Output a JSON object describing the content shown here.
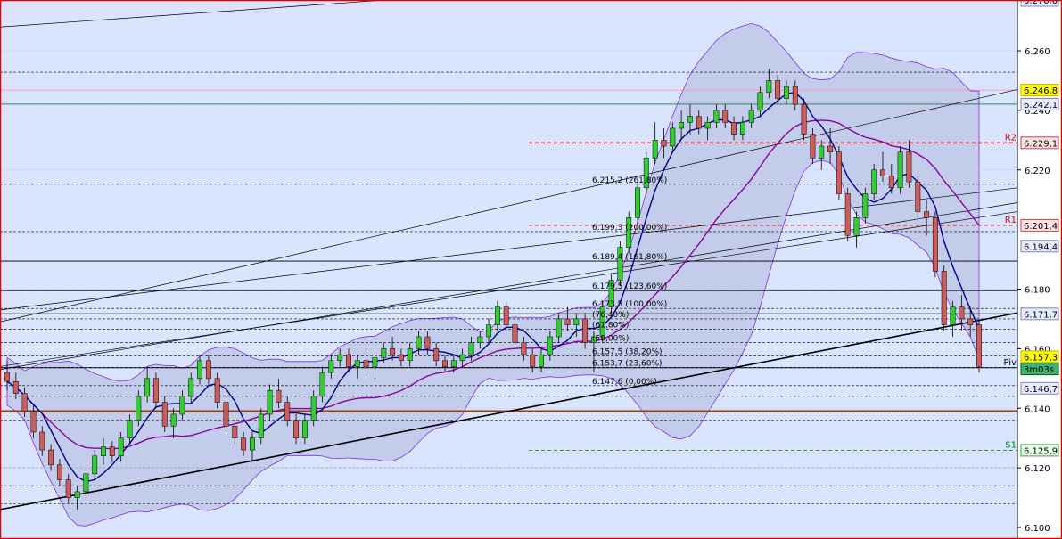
{
  "chart_data": {
    "type": "candlestick",
    "ylim": [
      6.1,
      6.265
    ],
    "y_ticks": [
      "6.100",
      "6.120",
      "6.140",
      "6.160",
      "6.180",
      "6.220",
      "6.240",
      "6.260"
    ],
    "candles": [
      [
        6.152,
        6.156,
        6.146,
        6.149
      ],
      [
        6.149,
        6.152,
        6.143,
        6.145
      ],
      [
        6.145,
        6.147,
        6.137,
        6.139
      ],
      [
        6.139,
        6.141,
        6.13,
        6.132
      ],
      [
        6.132,
        6.134,
        6.124,
        6.126
      ],
      [
        6.126,
        6.128,
        6.119,
        6.121
      ],
      [
        6.121,
        6.123,
        6.114,
        6.116
      ],
      [
        6.116,
        6.118,
        6.108,
        6.11
      ],
      [
        6.11,
        6.114,
        6.106,
        6.112
      ],
      [
        6.112,
        6.12,
        6.11,
        6.118
      ],
      [
        6.118,
        6.126,
        6.116,
        6.124
      ],
      [
        6.124,
        6.13,
        6.121,
        6.127
      ],
      [
        6.127,
        6.129,
        6.122,
        6.124
      ],
      [
        6.124,
        6.132,
        6.122,
        6.13
      ],
      [
        6.13,
        6.138,
        6.128,
        6.136
      ],
      [
        6.136,
        6.146,
        6.134,
        6.144
      ],
      [
        6.144,
        6.154,
        6.142,
        6.15
      ],
      [
        6.15,
        6.152,
        6.14,
        6.142
      ],
      [
        6.142,
        6.144,
        6.132,
        6.134
      ],
      [
        6.134,
        6.14,
        6.13,
        6.138
      ],
      [
        6.138,
        6.146,
        6.136,
        6.144
      ],
      [
        6.144,
        6.152,
        6.142,
        6.15
      ],
      [
        6.15,
        6.158,
        6.148,
        6.156
      ],
      [
        6.156,
        6.158,
        6.148,
        6.15
      ],
      [
        6.15,
        6.152,
        6.14,
        6.142
      ],
      [
        6.142,
        6.144,
        6.132,
        6.134
      ],
      [
        6.134,
        6.136,
        6.128,
        6.13
      ],
      [
        6.13,
        6.132,
        6.124,
        6.126
      ],
      [
        6.126,
        6.132,
        6.122,
        6.13
      ],
      [
        6.13,
        6.14,
        6.128,
        6.138
      ],
      [
        6.138,
        6.148,
        6.136,
        6.146
      ],
      [
        6.146,
        6.15,
        6.14,
        6.142
      ],
      [
        6.142,
        6.144,
        6.134,
        6.136
      ],
      [
        6.136,
        6.138,
        6.128,
        6.13
      ],
      [
        6.13,
        6.138,
        6.128,
        6.136
      ],
      [
        6.136,
        6.146,
        6.134,
        6.144
      ],
      [
        6.144,
        6.154,
        6.142,
        6.152
      ],
      [
        6.152,
        6.158,
        6.15,
        6.156
      ],
      [
        6.156,
        6.16,
        6.154,
        6.158
      ],
      [
        6.158,
        6.16,
        6.152,
        6.154
      ],
      [
        6.154,
        6.158,
        6.15,
        6.156
      ],
      [
        6.156,
        6.16,
        6.152,
        6.154
      ],
      [
        6.154,
        6.158,
        6.15,
        6.157
      ],
      [
        6.157,
        6.162,
        6.155,
        6.16
      ],
      [
        6.16,
        6.164,
        6.156,
        6.158
      ],
      [
        6.158,
        6.16,
        6.154,
        6.156
      ],
      [
        6.156,
        6.162,
        6.154,
        6.16
      ],
      [
        6.16,
        6.166,
        6.158,
        6.164
      ],
      [
        6.164,
        6.166,
        6.158,
        6.16
      ],
      [
        6.16,
        6.162,
        6.154,
        6.156
      ],
      [
        6.156,
        6.158,
        6.152,
        6.154
      ],
      [
        6.154,
        6.158,
        6.152,
        6.156
      ],
      [
        6.156,
        6.16,
        6.154,
        6.158
      ],
      [
        6.158,
        6.164,
        6.156,
        6.162
      ],
      [
        6.162,
        6.166,
        6.16,
        6.164
      ],
      [
        6.164,
        6.17,
        6.162,
        6.168
      ],
      [
        6.168,
        6.176,
        6.166,
        6.174
      ],
      [
        6.174,
        6.176,
        6.166,
        6.168
      ],
      [
        6.168,
        6.17,
        6.16,
        6.162
      ],
      [
        6.162,
        6.164,
        6.156,
        6.158
      ],
      [
        6.158,
        6.16,
        6.152,
        6.154
      ],
      [
        6.154,
        6.16,
        6.152,
        6.158
      ],
      [
        6.158,
        6.166,
        6.156,
        6.164
      ],
      [
        6.164,
        6.172,
        6.162,
        6.17
      ],
      [
        6.17,
        6.174,
        6.166,
        6.168
      ],
      [
        6.168,
        6.172,
        6.164,
        6.17
      ],
      [
        6.17,
        6.172,
        6.16,
        6.162
      ],
      [
        6.162,
        6.166,
        6.152,
        6.164
      ],
      [
        6.164,
        6.176,
        6.162,
        6.174
      ],
      [
        6.174,
        6.185,
        6.172,
        6.183
      ],
      [
        6.183,
        6.196,
        6.181,
        6.194
      ],
      [
        6.194,
        6.206,
        6.192,
        6.204
      ],
      [
        6.204,
        6.216,
        6.202,
        6.214
      ],
      [
        6.214,
        6.226,
        6.212,
        6.224
      ],
      [
        6.224,
        6.236,
        6.222,
        6.23
      ],
      [
        6.23,
        6.234,
        6.224,
        6.228
      ],
      [
        6.228,
        6.236,
        6.226,
        6.234
      ],
      [
        6.234,
        6.24,
        6.23,
        6.236
      ],
      [
        6.236,
        6.242,
        6.232,
        6.238
      ],
      [
        6.238,
        6.24,
        6.232,
        6.234
      ],
      [
        6.234,
        6.238,
        6.23,
        6.236
      ],
      [
        6.236,
        6.242,
        6.234,
        6.24
      ],
      [
        6.24,
        6.242,
        6.234,
        6.236
      ],
      [
        6.236,
        6.238,
        6.23,
        6.232
      ],
      [
        6.232,
        6.238,
        6.23,
        6.236
      ],
      [
        6.236,
        6.242,
        6.234,
        6.24
      ],
      [
        6.24,
        6.248,
        6.238,
        6.246
      ],
      [
        6.246,
        6.254,
        6.244,
        6.25
      ],
      [
        6.25,
        6.252,
        6.242,
        6.244
      ],
      [
        6.244,
        6.25,
        6.242,
        6.248
      ],
      [
        6.248,
        6.25,
        6.24,
        6.242
      ],
      [
        6.242,
        6.244,
        6.23,
        6.232
      ],
      [
        6.232,
        6.234,
        6.222,
        6.224
      ],
      [
        6.224,
        6.23,
        6.22,
        6.228
      ],
      [
        6.228,
        6.234,
        6.222,
        6.226
      ],
      [
        6.226,
        6.228,
        6.21,
        6.212
      ],
      [
        6.212,
        6.214,
        6.196,
        6.198
      ],
      [
        6.198,
        6.206,
        6.194,
        6.204
      ],
      [
        6.204,
        6.214,
        6.202,
        6.212
      ],
      [
        6.212,
        6.222,
        6.21,
        6.22
      ],
      [
        6.22,
        6.226,
        6.216,
        6.218
      ],
      [
        6.218,
        6.222,
        6.212,
        6.214
      ],
      [
        6.214,
        6.228,
        6.212,
        6.226
      ],
      [
        6.226,
        6.23,
        6.214,
        6.216
      ],
      [
        6.216,
        6.218,
        6.204,
        6.206
      ],
      [
        6.206,
        6.21,
        6.198,
        6.204
      ],
      [
        6.204,
        6.206,
        6.184,
        6.186
      ],
      [
        6.186,
        6.188,
        6.166,
        6.168
      ],
      [
        6.168,
        6.176,
        6.164,
        6.174
      ],
      [
        6.174,
        6.178,
        6.166,
        6.17
      ],
      [
        6.17,
        6.174,
        6.164,
        6.168
      ],
      [
        6.168,
        6.17,
        6.152,
        6.154
      ]
    ],
    "levels": [
      {
        "value": 6.2468,
        "label": "6.246,8",
        "color": "#fffd00",
        "border": "#c8b400"
      },
      {
        "value": 6.2421,
        "label": "6.242,1",
        "color": "#e8ecff",
        "border": "#8080c0"
      },
      {
        "value": 6.2291,
        "label": "6.229,1",
        "color": "#ffe6e6",
        "border": "#d04040",
        "text": "#c00000"
      },
      {
        "value": 6.2014,
        "label": "6.201,4",
        "color": "#ffe6e6",
        "border": "#d04040",
        "text": "#c00000"
      },
      {
        "value": 6.1944,
        "label": "6.194,4",
        "color": "#e8ecff",
        "border": "#8080c0"
      },
      {
        "value": 6.1717,
        "label": "6.171,7",
        "color": "#e8ecff",
        "border": "#8080c0"
      },
      {
        "value": 6.1573,
        "label": "6.157,3",
        "color": "#fffd00",
        "border": "#c8b400"
      },
      {
        "value": 6.1467,
        "label": "6.146,7",
        "color": "#e8ecff",
        "border": "#8080c0"
      },
      {
        "value": 6.1259,
        "label": "6.125,9",
        "color": "#e6ffe6",
        "border": "#40a040",
        "text": "#006000"
      }
    ],
    "timer": {
      "value": 6.1532,
      "label": "3m03s"
    },
    "top_partial_label": "6.270,0",
    "pivots": [
      {
        "name": "R2",
        "value": 6.2291,
        "color": "#e00000"
      },
      {
        "name": "R1",
        "value": 6.2014,
        "color": "#e00000"
      },
      {
        "name": "Piv",
        "value": 6.1536,
        "color": "#000000"
      },
      {
        "name": "S1",
        "value": 6.1259,
        "color": "#008000"
      }
    ],
    "fibonacci": [
      {
        "label": "6.215,2 (261,80%)",
        "value": 6.2152
      },
      {
        "label": "6.199,3 (200,00%)",
        "value": 6.1993
      },
      {
        "label": "6.189,4 (161,80%)",
        "value": 6.1894
      },
      {
        "label": "6.179,5 (123,60%)",
        "value": 6.1795
      },
      {
        "label": "6.173,5 (100,00%)",
        "value": 6.1735
      },
      {
        "label": "(76,40%)",
        "value": 6.17
      },
      {
        "label": "(61,80%)",
        "value": 6.1665
      },
      {
        "label": "(50,00%)",
        "value": 6.162
      },
      {
        "label": "6.157,5 (38,20%)",
        "value": 6.1575
      },
      {
        "label": "6.153,7 (23,60%)",
        "value": 6.1537
      },
      {
        "label": "6.147,6 (0,00%)",
        "value": 6.1476
      }
    ],
    "horizontal_lines": [
      6.2528,
      6.2421,
      6.2152,
      6.1993,
      6.1894,
      6.1795,
      6.1735,
      6.17,
      6.1665,
      6.162,
      6.1575,
      6.1537,
      6.1476,
      6.144,
      6.139,
      6.136,
      6.12,
      6.114,
      6.108
    ]
  }
}
